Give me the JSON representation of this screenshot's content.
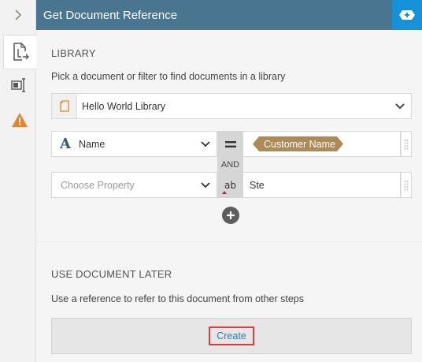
{
  "header": {
    "title": "Get Document Reference"
  },
  "rail": {
    "toggle_icon": "chevron-right-icon",
    "tabs": [
      {
        "icon": "document-export-icon",
        "active": true
      },
      {
        "icon": "form-field-icon",
        "active": false
      },
      {
        "icon": "warning-icon",
        "active": false
      }
    ]
  },
  "library": {
    "title": "LIBRARY",
    "description": "Pick a document or filter to find documents in a library",
    "selected": "Hello World Library"
  },
  "filters": [
    {
      "property": "Name",
      "operator": "=",
      "value_token": "Customer Name",
      "property_icon": "text-type-icon"
    },
    {
      "property_placeholder": "Choose Property",
      "operator": "ab",
      "value": "Ste"
    }
  ],
  "joiner": "AND",
  "use_later": {
    "title": "USE DOCUMENT LATER",
    "description": "Use a reference to refer to this document from other steps",
    "create_label": "Create"
  },
  "colors": {
    "header": "#4a7590",
    "header_action": "#1592d8",
    "token": "#b08a55",
    "warning": "#e8832e",
    "link": "#1e7fc2",
    "highlight": "#e03b3b"
  }
}
